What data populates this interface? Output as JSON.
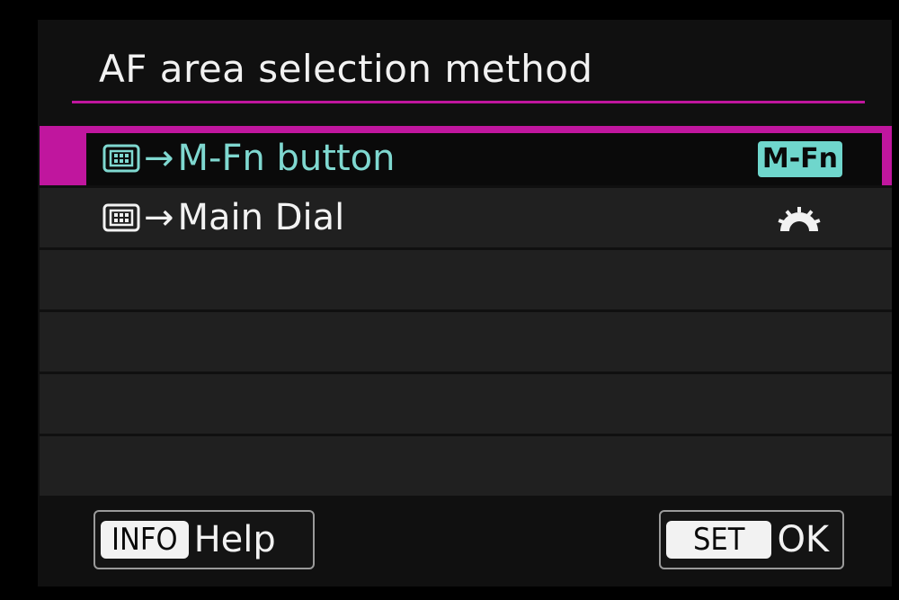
{
  "title": "AF area selection method",
  "menu_items": [
    {
      "label": "M-Fn button",
      "arrow": "→",
      "icon": "af-area-icon",
      "badge": "M-Fn",
      "selected": true
    },
    {
      "label": "Main Dial",
      "arrow": "→",
      "icon": "af-area-icon",
      "trailing_icon": "main-dial-icon",
      "selected": false
    }
  ],
  "footer": {
    "info_key": "INFO",
    "info_label": "Help",
    "set_key": "SET",
    "set_label": "OK"
  },
  "colors": {
    "accent": "#c0169e",
    "selected_text": "#7fd8d0",
    "badge_bg": "#6fd6cc",
    "row_bg": "#202020"
  }
}
